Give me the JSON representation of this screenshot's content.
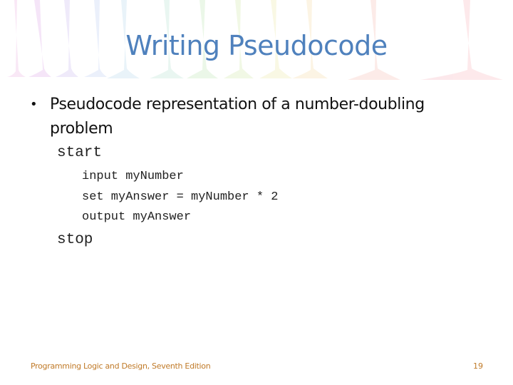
{
  "slide": {
    "title": "Writing Pseudocode",
    "bullet": {
      "icon": "bullet-dot",
      "text_line1": "Pseudocode representation of a number-doubling",
      "text_line2": "problem"
    },
    "code": {
      "start": "start",
      "lines": [
        "input myNumber",
        "set myAnswer = myNumber * 2",
        "output myAnswer"
      ],
      "stop": "stop"
    },
    "footer": {
      "book": "Programming Logic and Design, Seventh Edition",
      "page_number": "19"
    },
    "colors": {
      "title": "#4f81bd",
      "footer": "#c07a28",
      "body_text": "#111111"
    }
  }
}
